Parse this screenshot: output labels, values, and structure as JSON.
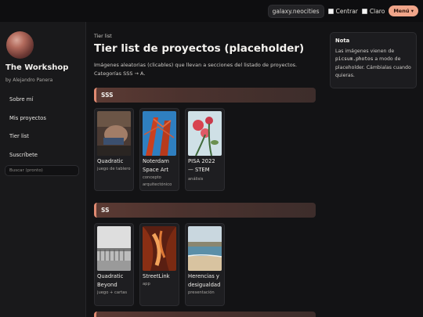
{
  "topbar": {
    "domain": "galaxy.neocities",
    "toggle_center": "Centrar",
    "toggle_light": "Claro",
    "menu_label": "Menú ▾"
  },
  "sidebar": {
    "site_title": "The Workshop",
    "author": "by Alejandro Panera",
    "items": [
      {
        "label": "Sobre mí"
      },
      {
        "label": "Mis proyectos"
      },
      {
        "label": "Tier list"
      },
      {
        "label": "Suscríbete"
      }
    ],
    "search_placeholder": "Buscar (pronto)"
  },
  "main": {
    "eyebrow": "Tier list",
    "title": "Tier list de proyectos (placeholder)",
    "intro": "Imágenes aleatorias (clicables) que llevan a secciones del listado de proyectos. Categorías SSS → A.",
    "tiers": [
      {
        "label": "SSS",
        "cards": [
          {
            "title": "Quadratic",
            "tag": "juego de tablero"
          },
          {
            "title": "Noterdam Space Art",
            "tag": "concepto arquitectónico"
          },
          {
            "title": "PISA 2022 — STEM",
            "tag": "análisis"
          }
        ]
      },
      {
        "label": "SS",
        "cards": [
          {
            "title": "Quadratic Beyond",
            "tag": "juego + cartas"
          },
          {
            "title": "StreetLink",
            "tag": "app"
          },
          {
            "title": "Herencias y desigualdad",
            "tag": "presentación"
          }
        ]
      }
    ]
  },
  "aside": {
    "title": "Nota",
    "text_before": "Las imágenes vienen de",
    "code": "picsum.photos",
    "text_after": "a modo de placeholder. Cámbialas cuando quieras."
  }
}
